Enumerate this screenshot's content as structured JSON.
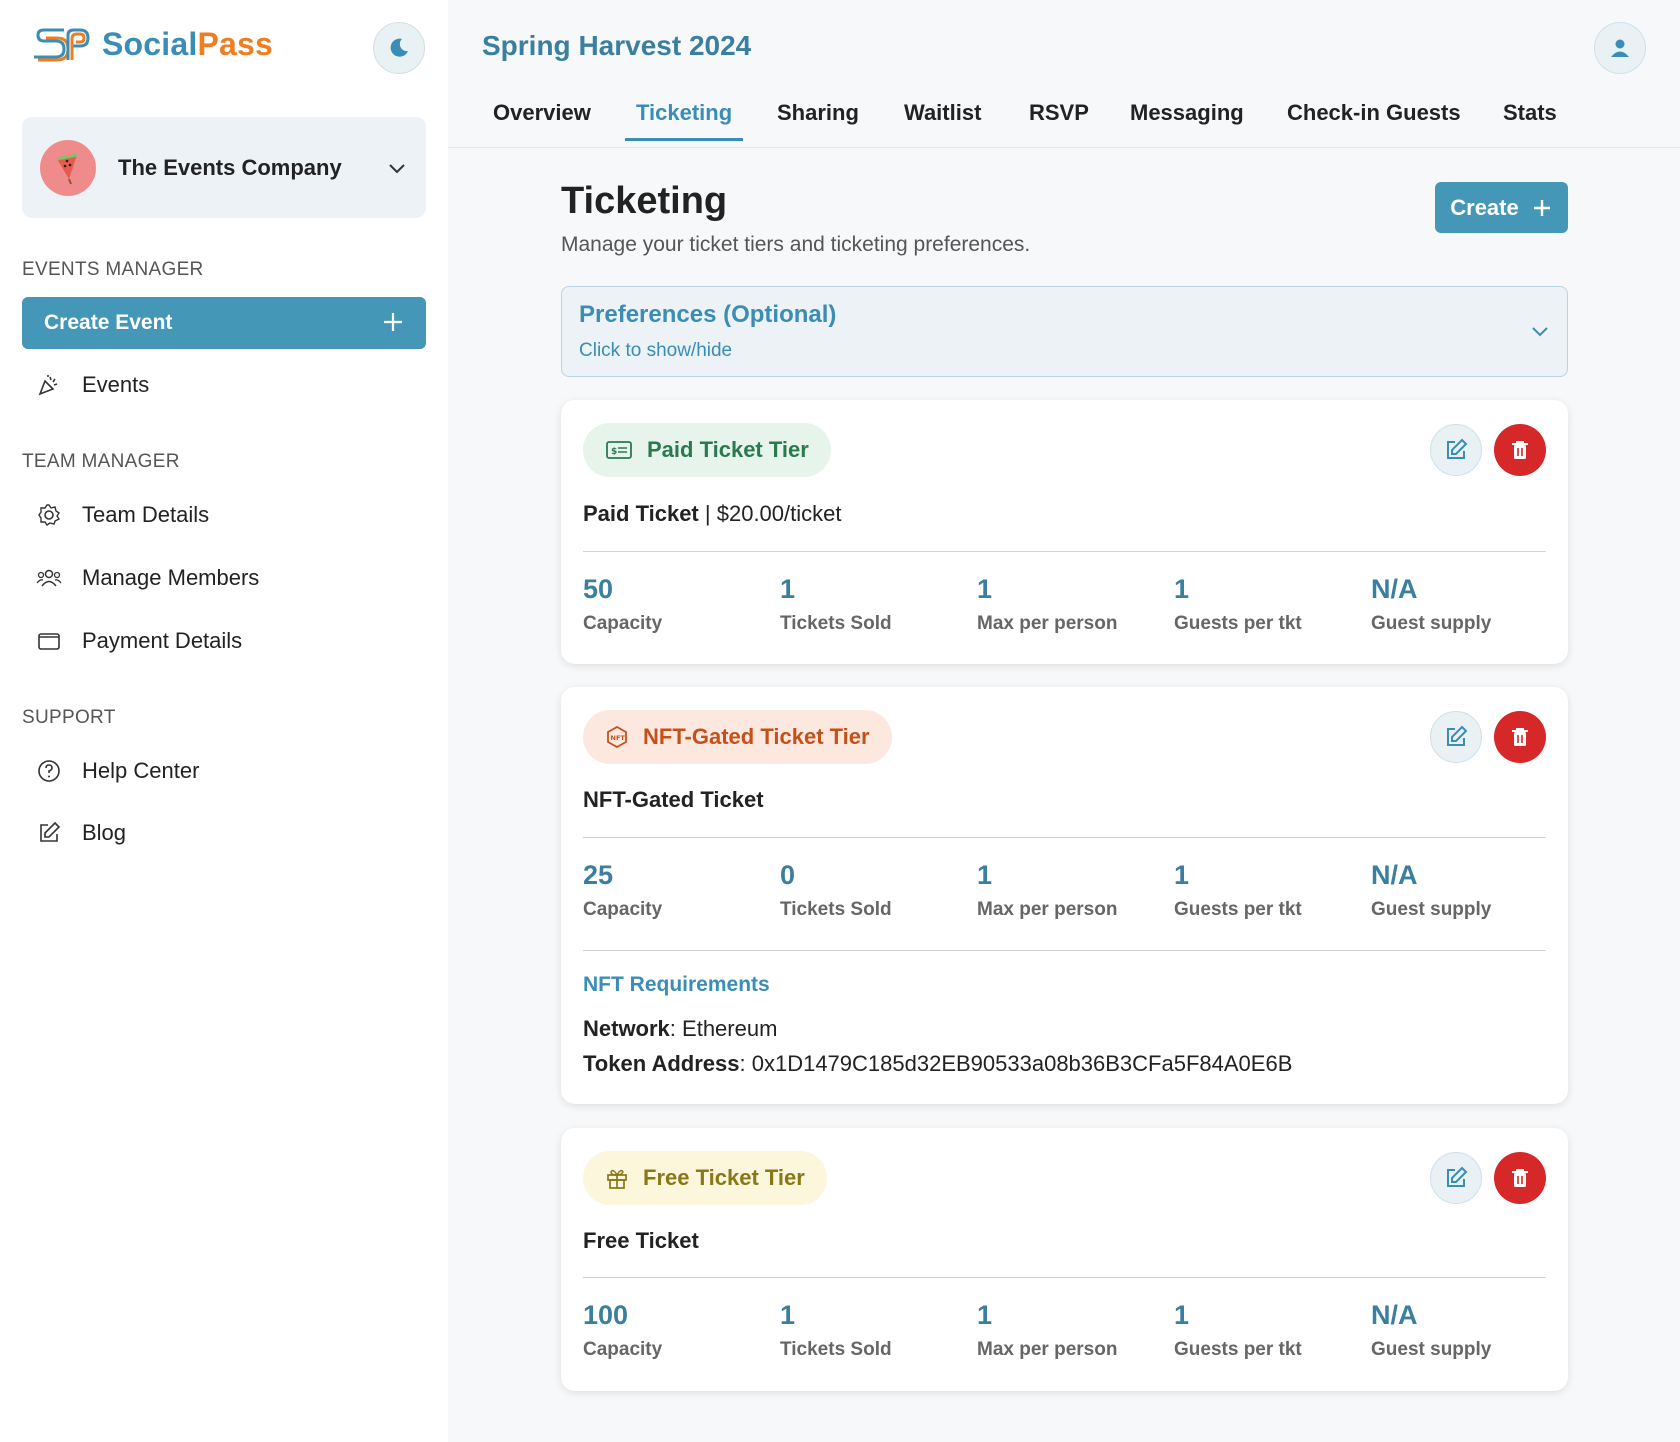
{
  "brand": {
    "name_part1": "Social",
    "name_part2": "Pass",
    "color_primary": "#3a8db4",
    "color_accent": "#ef7d22"
  },
  "sidebar": {
    "org_name": "The Events Company",
    "sections": {
      "events": "EVENTS MANAGER",
      "team": "TEAM MANAGER",
      "support": "SUPPORT"
    },
    "create_event_label": "Create Event",
    "items": [
      {
        "label": "Events",
        "icon": "party-popper-icon"
      },
      {
        "label": "Team Details",
        "icon": "gear-icon"
      },
      {
        "label": "Manage Members",
        "icon": "users-icon"
      },
      {
        "label": "Payment Details",
        "icon": "wallet-icon"
      },
      {
        "label": "Help Center",
        "icon": "help-circle-icon"
      },
      {
        "label": "Blog",
        "icon": "pencil-square-icon"
      }
    ]
  },
  "header": {
    "event_title": "Spring Harvest 2024",
    "tabs": [
      "Overview",
      "Ticketing",
      "Sharing",
      "Waitlist",
      "RSVP",
      "Messaging",
      "Check-in Guests",
      "Stats"
    ],
    "active_tab": "Ticketing"
  },
  "main": {
    "title": "Ticketing",
    "subtitle": "Manage your ticket tiers and ticketing preferences.",
    "create_label": "Create",
    "preferences": {
      "title": "Preferences (Optional)",
      "subtitle": "Click to show/hide"
    }
  },
  "stat_labels": [
    "Capacity",
    "Tickets Sold",
    "Max per person",
    "Guests per tkt",
    "Guest supply"
  ],
  "tiers": [
    {
      "badge": "Paid Ticket Tier",
      "name": "Paid Ticket",
      "price": "$20.00/ticket",
      "price_sep": "|",
      "stats": [
        "50",
        "1",
        "1",
        "1",
        "N/A"
      ]
    },
    {
      "badge": "NFT-Gated Ticket Tier",
      "name": "NFT-Gated Ticket",
      "stats": [
        "25",
        "0",
        "1",
        "1",
        "N/A"
      ],
      "nft_requirements": {
        "title": "NFT Requirements",
        "network_label": "Network",
        "network": "Ethereum",
        "token_label": "Token Address",
        "token": "0x1D1479C185d32EB90533a08b36B3CFa5F84A0E6B"
      }
    },
    {
      "badge": "Free Ticket Tier",
      "name": "Free Ticket",
      "stats": [
        "100",
        "1",
        "1",
        "1",
        "N/A"
      ]
    }
  ]
}
